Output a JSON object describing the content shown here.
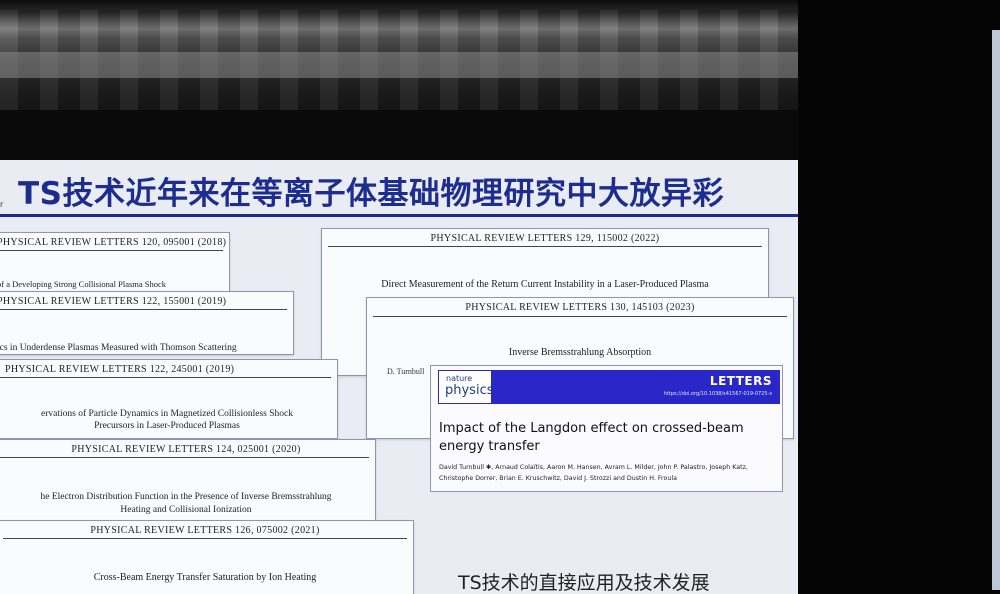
{
  "slide": {
    "title": "TS技术近年来在等离子体基础物理研究中大放异彩",
    "left_tag": "r",
    "bottom_caption": "TS技术的直接应用及技术发展"
  },
  "cards": [
    {
      "header": "PHYSICAL REVIEW LETTERS 120, 095001 (2018)",
      "title": "of a Developing Strong Collisional Plasma Shock"
    },
    {
      "header": "PHYSICAL REVIEW LETTERS 122, 155001 (2019)",
      "title": "ics in Underdense Plasmas Measured with Thomson Scattering"
    },
    {
      "header": "PHYSICAL REVIEW LETTERS 122, 245001 (2019)",
      "title": "ervations of Particle Dynamics in Magnetized Collisionless Shock",
      "title2": "Precursors in Laser-Produced Plasmas"
    },
    {
      "header": "PHYSICAL REVIEW LETTERS 124, 025001 (2020)",
      "title": "he Electron Distribution Function in the Presence of Inverse Bremsstrahlung",
      "title2": "Heating and Collisional Ionization"
    },
    {
      "header": "PHYSICAL REVIEW LETTERS 126, 075002 (2021)",
      "title": "Cross-Beam Energy Transfer Saturation by Ion Heating"
    },
    {
      "header": "PHYSICAL REVIEW LETTERS 129, 115002 (2022)",
      "title": "Direct Measurement of the Return Current Instability in a Laser-Produced Plasma"
    },
    {
      "header": "PHYSICAL REVIEW LETTERS 130, 145103 (2023)",
      "title": "Inverse Bremsstrahlung Absorption",
      "author": "D. Turnbull"
    }
  ],
  "nature_paper": {
    "journal_line1": "nature",
    "journal_line2": "physics",
    "section": "LETTERS",
    "doi": "https://doi.org/10.1038/s41567-019-0725-z",
    "title": "Impact of the Langdon effect on crossed-beam energy transfer",
    "authors": "David Turnbull ✱, Arnaud Colaïtis, Aaron M. Hansen, Avram L. Milder, John P. Palastro, Joseph Katz, Christophe Dorrer, Brian E. Kruschwitz, David J. Strozzi and Dustin H. Froula"
  },
  "colors": {
    "title_blue": "#1d2d8f",
    "nature_band": "#2a27c8",
    "screen_bg": "#e9ecf3"
  }
}
